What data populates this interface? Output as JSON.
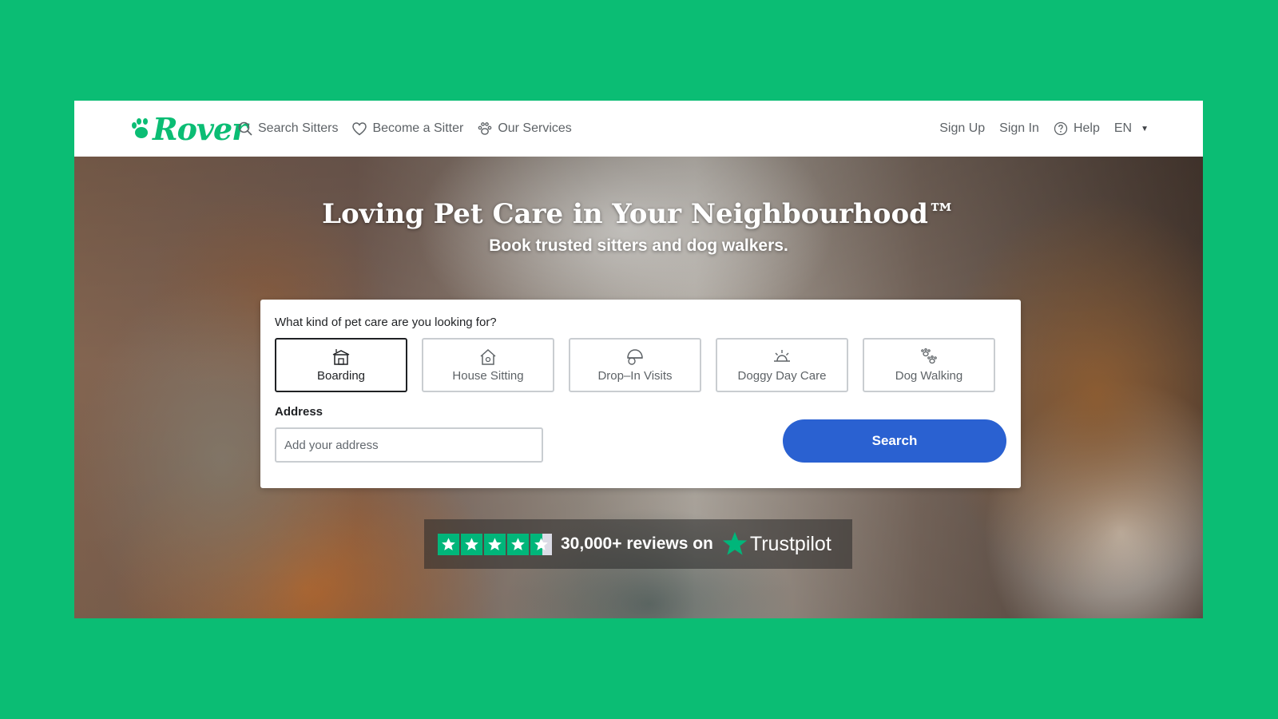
{
  "brand": {
    "logo_text": "Rover",
    "color": "#0bbd74"
  },
  "header": {
    "nav": [
      {
        "label": "Search Sitters",
        "icon": "search-icon"
      },
      {
        "label": "Become a Sitter",
        "icon": "heart-icon"
      },
      {
        "label": "Our Services",
        "icon": "paw-icon"
      }
    ],
    "sign_up": "Sign Up",
    "sign_in": "Sign In",
    "help": "Help",
    "language": "EN"
  },
  "hero": {
    "title": "Loving Pet Care in Your Neighbourhood™",
    "subtitle": "Book trusted sitters and dog walkers."
  },
  "search_card": {
    "question": "What kind of pet care are you looking for?",
    "services": [
      {
        "label": "Boarding",
        "icon": "boarding-icon",
        "selected": true
      },
      {
        "label": "House Sitting",
        "icon": "house-icon",
        "selected": false
      },
      {
        "label": "Drop–In Visits",
        "icon": "drop-in-icon",
        "selected": false
      },
      {
        "label": "Doggy Day Care",
        "icon": "sun-icon",
        "selected": false
      },
      {
        "label": "Dog Walking",
        "icon": "paws-icon",
        "selected": false
      }
    ],
    "address_label": "Address",
    "address_placeholder": "Add your address",
    "address_value": "",
    "search_label": "Search",
    "search_color": "#2a61d1"
  },
  "trustpilot": {
    "rating_stars": 4.5,
    "text": "30,000+ reviews on",
    "brand": "Trustpilot",
    "color": "#00b67a"
  }
}
